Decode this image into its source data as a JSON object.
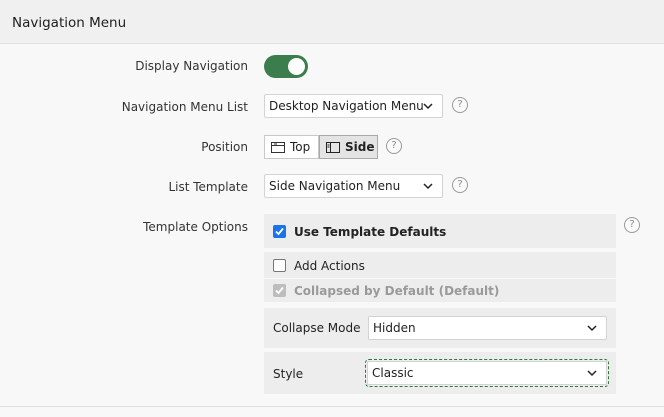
{
  "header": {
    "title": "Navigation Menu"
  },
  "display_navigation": {
    "label": "Display Navigation",
    "enabled": true
  },
  "navigation_menu_list": {
    "label": "Navigation Menu List",
    "value": "Desktop Navigation Menu"
  },
  "position": {
    "label": "Position",
    "options": [
      {
        "label": "Top"
      },
      {
        "label": "Side"
      }
    ],
    "selected": "Side"
  },
  "list_template": {
    "label": "List Template",
    "value": "Side Navigation Menu"
  },
  "template_options": {
    "label": "Template Options",
    "use_defaults": {
      "label": "Use Template Defaults",
      "checked": true
    },
    "add_actions": {
      "label": "Add Actions",
      "checked": false
    },
    "collapsed_default": {
      "label": "Collapsed by Default (Default)",
      "checked": true,
      "disabled": true
    },
    "collapse_mode": {
      "label": "Collapse Mode",
      "value": "Hidden"
    },
    "style": {
      "label": "Style",
      "value": "Classic"
    }
  },
  "help_glyph": "?"
}
